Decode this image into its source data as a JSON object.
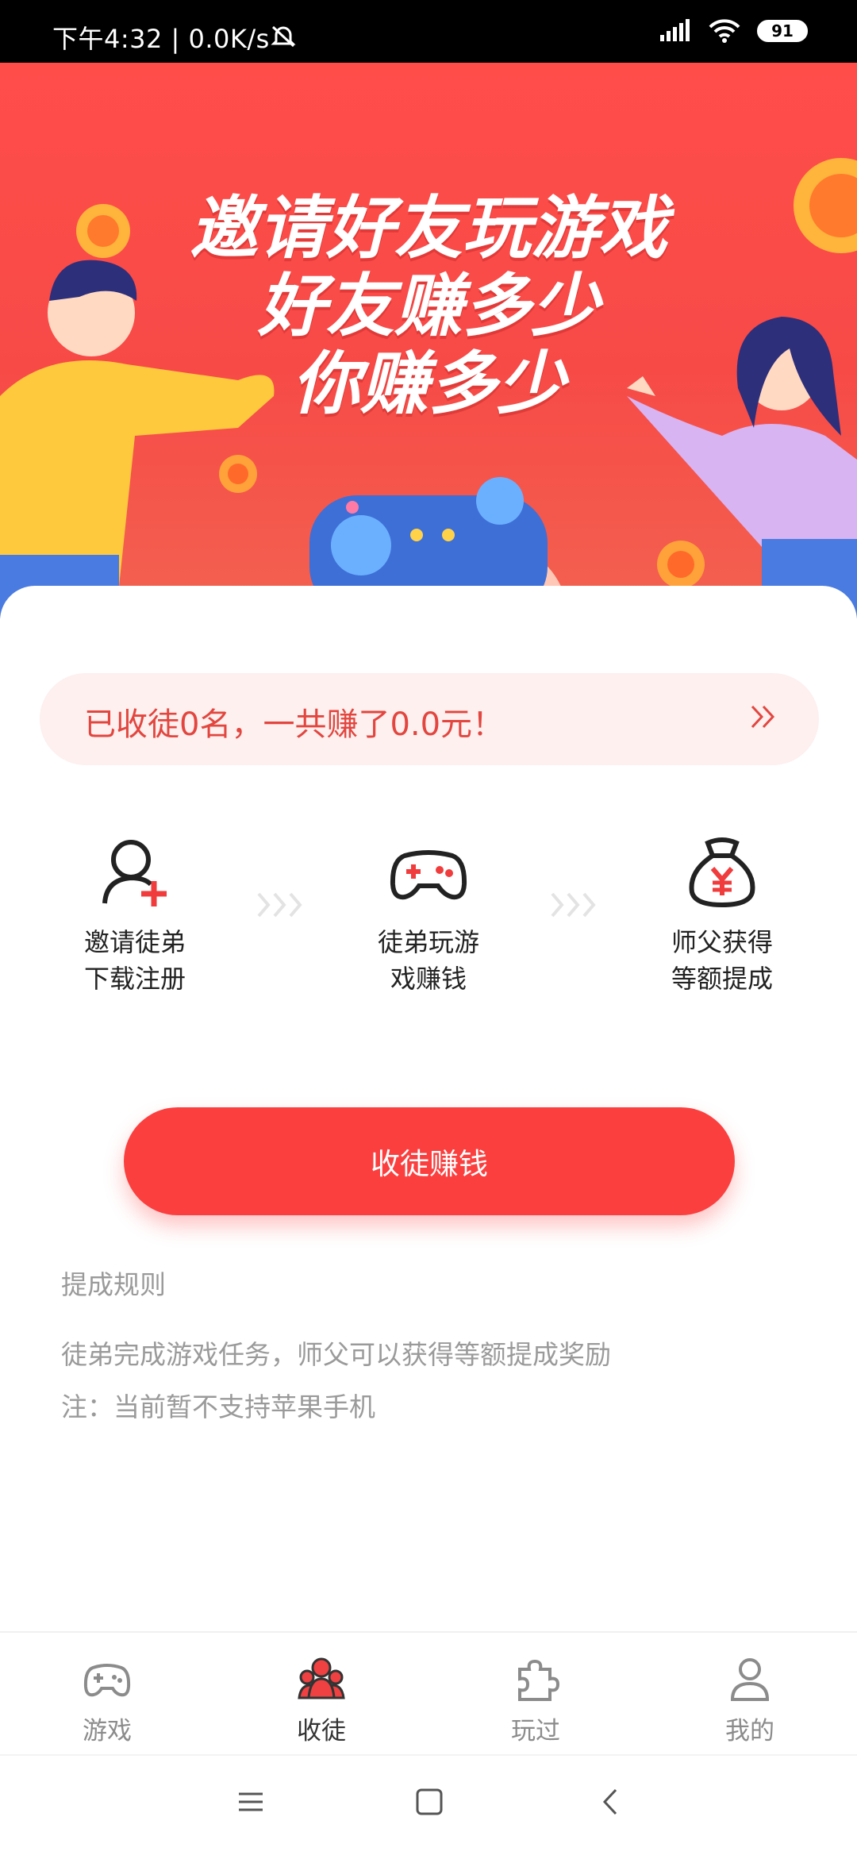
{
  "status_bar": {
    "time_text": "下午4:32 | 0.0K/s",
    "battery": "91",
    "icons": [
      "mute-icon",
      "signal-icon",
      "wifi-icon",
      "battery-icon"
    ]
  },
  "banner": {
    "title_lines": [
      "邀请好友玩游戏",
      "好友赚多少",
      "你赚多少"
    ]
  },
  "stats": {
    "text": "已收徒0名，一共赚了0.0元！"
  },
  "steps": [
    {
      "icon": "invite-user-icon",
      "line1": "邀请徒弟",
      "line2": "下载注册"
    },
    {
      "icon": "gamepad-icon",
      "line1": "徒弟玩游",
      "line2": "戏赚钱"
    },
    {
      "icon": "money-bag-icon",
      "line1": "师父获得",
      "line2": "等额提成"
    }
  ],
  "cta": {
    "label": "收徒赚钱"
  },
  "rules": {
    "title": "提成规则",
    "lines": [
      "徒弟完成游戏任务，师父可以获得等额提成奖励",
      "注：当前暂不支持苹果手机"
    ]
  },
  "tabs": [
    {
      "label": "游戏",
      "icon": "gamepad-icon",
      "active": false
    },
    {
      "label": "收徒",
      "icon": "apprentice-icon",
      "active": true
    },
    {
      "label": "玩过",
      "icon": "puzzle-icon",
      "active": false
    },
    {
      "label": "我的",
      "icon": "profile-icon",
      "active": false
    }
  ],
  "colors": {
    "primary": "#fb3f3f",
    "banner": "#f74a47",
    "stats_bg": "#fdf0ef",
    "muted_text": "#9a9a9a"
  }
}
